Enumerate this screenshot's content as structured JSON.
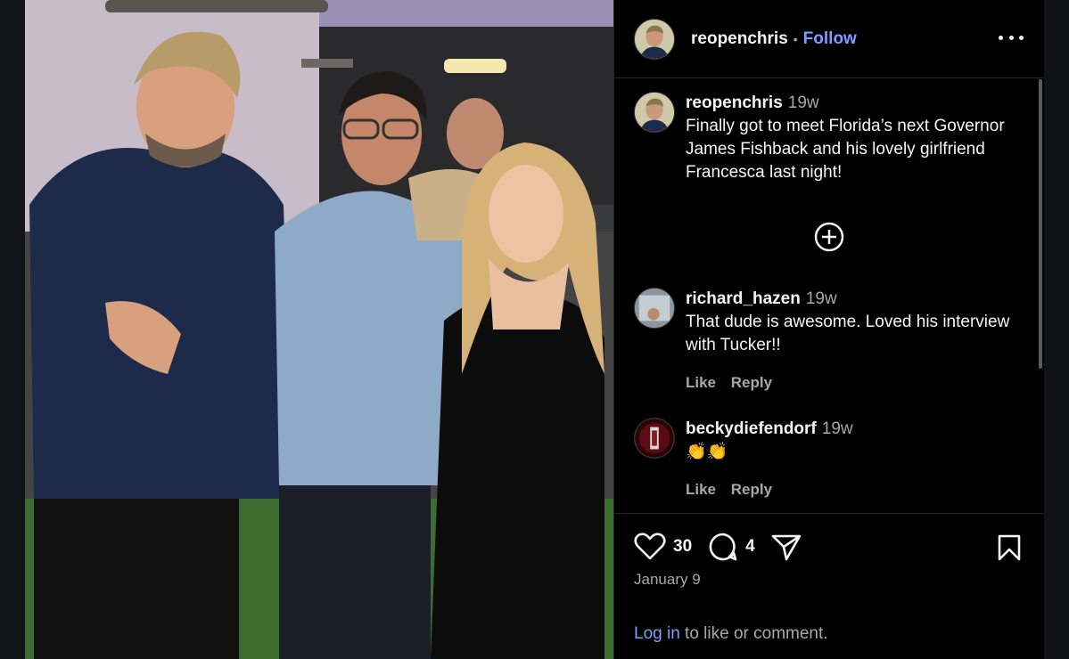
{
  "post": {
    "author": "reopenchris",
    "separator": "•",
    "follow_label": "Follow",
    "more_icon": "more-horizontal-icon"
  },
  "caption": {
    "username": "reopenchris",
    "time": "19w",
    "text": "Finally got to meet Florida’s next Governor James Fishback and his lovely girlfriend Francesca last night!"
  },
  "add_icon": "plus-circle-icon",
  "comments": [
    {
      "username": "richard_hazen",
      "time": "19w",
      "text": "That dude is awesome. Loved his interview with Tucker!!",
      "like_label": "Like",
      "reply_label": "Reply"
    },
    {
      "username": "beckydiefendorf",
      "time": "19w",
      "text": "👏👏",
      "like_label": "Like",
      "reply_label": "Reply"
    }
  ],
  "footer": {
    "like_count": "30",
    "comment_count": "4",
    "date": "January 9",
    "login_link": "Log in",
    "login_suffix": " to like or comment."
  },
  "colors": {
    "background": "#000000",
    "link": "#7d9cff",
    "muted": "#a8a8a8"
  }
}
